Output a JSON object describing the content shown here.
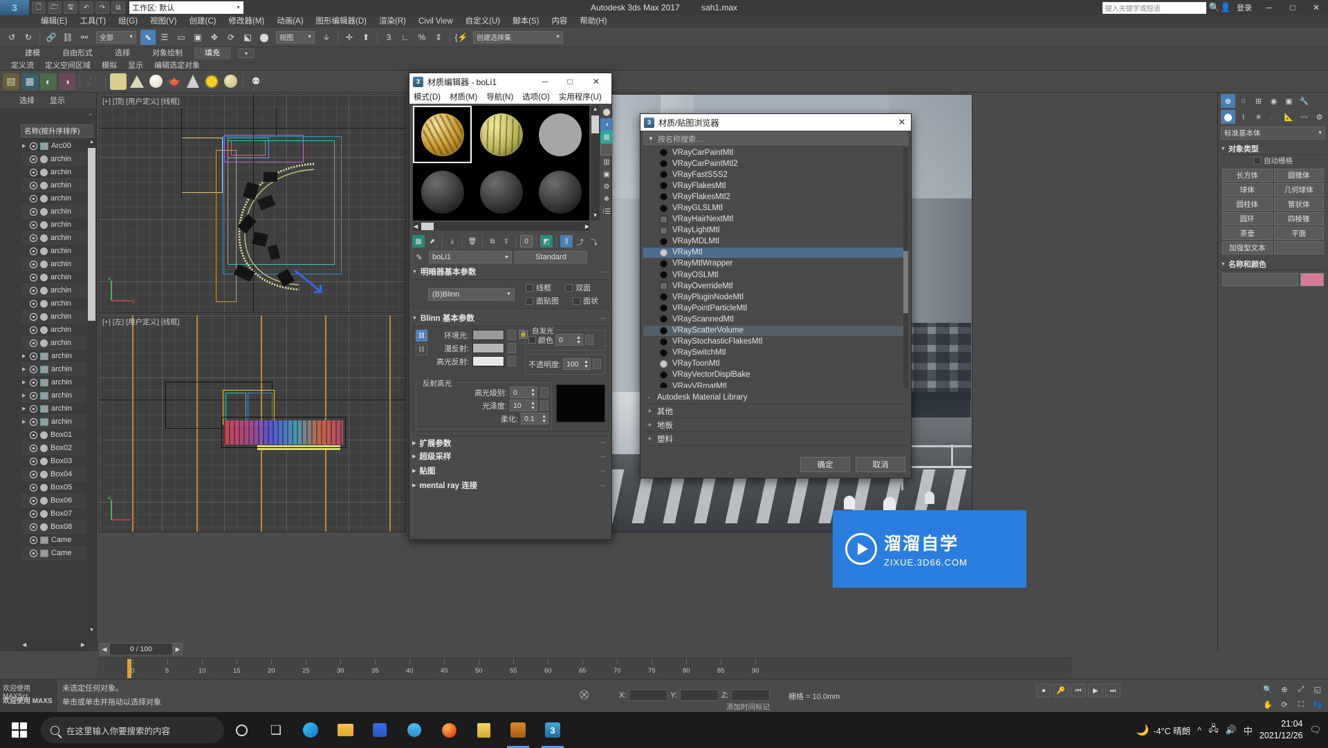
{
  "titlebar": {
    "logo": "MAX",
    "workspace": "工作区: 默认",
    "title": "Autodesk 3ds Max 2017",
    "filename": "sah1.max",
    "search_placeholder": "键入关键字或短语",
    "login": "登录",
    "icons": [
      "new-icon",
      "open-icon",
      "save-icon",
      "undo-icon",
      "redo-icon",
      "set-icon"
    ],
    "min": "─",
    "max": "□",
    "close": "✕"
  },
  "menubar": {
    "items": [
      "编辑(E)",
      "工具(T)",
      "组(G)",
      "视图(V)",
      "创建(C)",
      "修改器(M)",
      "动画(A)",
      "图形编辑器(D)",
      "渲染(R)",
      "Civil View",
      "自定义(U)",
      "脚本(S)",
      "内容",
      "帮助(H)"
    ]
  },
  "maintoolbar": {
    "select_filter": "全部",
    "ref_coord": "视图",
    "selection_set": "创建选择集"
  },
  "ribbon": {
    "tabs": [
      "建模",
      "自由形式",
      "选择",
      "对象绘制",
      "填充"
    ],
    "selected_tab": "填充",
    "subtabs": [
      "定义流",
      "定义空间区域",
      "模拟",
      "显示",
      "编辑选定对象"
    ]
  },
  "left_panel": {
    "tabs": [
      "选择",
      "显示"
    ],
    "column_header": "名称(按升序排序)",
    "items": [
      {
        "label": "Arc00",
        "type": "group"
      },
      {
        "label": "archin",
        "type": "obj"
      },
      {
        "label": "archin",
        "type": "obj"
      },
      {
        "label": "archin",
        "type": "obj"
      },
      {
        "label": "archin",
        "type": "obj"
      },
      {
        "label": "archin",
        "type": "obj"
      },
      {
        "label": "archin",
        "type": "obj"
      },
      {
        "label": "archin",
        "type": "obj"
      },
      {
        "label": "archin",
        "type": "obj"
      },
      {
        "label": "archin",
        "type": "obj"
      },
      {
        "label": "archin",
        "type": "obj"
      },
      {
        "label": "archin",
        "type": "obj"
      },
      {
        "label": "archin",
        "type": "obj"
      },
      {
        "label": "archin",
        "type": "obj"
      },
      {
        "label": "archin",
        "type": "obj"
      },
      {
        "label": "archin",
        "type": "obj"
      },
      {
        "label": "archin",
        "type": "grp"
      },
      {
        "label": "archin",
        "type": "grp"
      },
      {
        "label": "archin",
        "type": "grp"
      },
      {
        "label": "archin",
        "type": "grp"
      },
      {
        "label": "archin",
        "type": "grp"
      },
      {
        "label": "archin",
        "type": "grp"
      },
      {
        "label": "Box01",
        "type": "obj"
      },
      {
        "label": "Box02",
        "type": "obj"
      },
      {
        "label": "Box03",
        "type": "obj"
      },
      {
        "label": "Box04",
        "type": "obj"
      },
      {
        "label": "Box05",
        "type": "obj"
      },
      {
        "label": "Box06",
        "type": "obj"
      },
      {
        "label": "Box07",
        "type": "obj"
      },
      {
        "label": "Box08",
        "type": "obj"
      },
      {
        "label": "Came",
        "type": "cam"
      },
      {
        "label": "Came",
        "type": "cam"
      }
    ]
  },
  "viewports": {
    "top": "[+] [顶] [用户定义] [线框]",
    "left": "[+] [左] [用户定义] [线框]",
    "persp": "[+] [透视] [真实]"
  },
  "timeline": {
    "frame_display": "0 / 100",
    "ticks": [
      "0",
      "5",
      "10",
      "15",
      "20",
      "25",
      "30",
      "35",
      "40",
      "45",
      "50",
      "55",
      "60",
      "65",
      "70",
      "75",
      "80",
      "85",
      "90"
    ]
  },
  "status": {
    "maxscript_line1": "欢迎使用 MAXScr",
    "maxscript_line2": "欢迎使用 MAXS",
    "line1": "未选定任何对象。",
    "line2": "单击或单击并拖动以选择对象",
    "x_label": "X:",
    "y_label": "Y:",
    "z_label": "Z:",
    "x_value": "",
    "y_value": "",
    "z_value": "",
    "grid": "栅格 = 10.0mm",
    "addkey": "添加时间标记"
  },
  "command_panel": {
    "object_type_label": "对象类型",
    "autogrid": "自动栅格",
    "category": "标准基本体",
    "buttons": [
      "长方体",
      "圆锥体",
      "球体",
      "几何球体",
      "圆柱体",
      "管状体",
      "圆环",
      "四棱锥",
      "茶壶",
      "平面",
      "加强型文本",
      ""
    ],
    "name_color_label": "名称和颜色",
    "color": "#d67a96"
  },
  "material_editor": {
    "title": "材质编辑器 - boLi1",
    "menu": [
      "模式(D)",
      "材质(M)",
      "导航(N)",
      "选项(O)",
      "实用程序(U)"
    ],
    "material_name": "boLi1",
    "type_button": "Standard",
    "shader_rollout": "明暗器基本参数",
    "shader_type": "(B)Blinn",
    "wire_label": "线框",
    "twosided_label": "双面",
    "facemap_label": "面贴图",
    "faceted_label": "面状",
    "basic_rollout": "Blinn 基本参数",
    "ambient_label": "环境光:",
    "diffuse_label": "漫反射:",
    "specular_label": "高光反射:",
    "selfillum_group": "自发光",
    "color_label": "颜色",
    "selfillum_value": "0",
    "opacity_label": "不透明度:",
    "opacity_value": "100",
    "spechl_group": "反射高光",
    "speclevel_label": "高光级别:",
    "speclevel_value": "0",
    "glossiness_label": "光泽度:",
    "glossiness_value": "10",
    "soften_label": "柔化:",
    "soften_value": "0.1",
    "rollouts": [
      "扩展参数",
      "超级采样",
      "贴图",
      "mental ray 连接"
    ]
  },
  "material_browser": {
    "title": "材质/贴图浏览器",
    "search_placeholder": "按名称搜索…",
    "items": [
      {
        "label": "VRayCarPaintMtl",
        "icon": "dark"
      },
      {
        "label": "VRayCarPaintMtl2",
        "icon": "dark"
      },
      {
        "label": "VRayFastSSS2",
        "icon": "dark"
      },
      {
        "label": "VRayFlakesMtl",
        "icon": "dark"
      },
      {
        "label": "VRayFlakesMtl2",
        "icon": "dark"
      },
      {
        "label": "VRayGLSLMtl",
        "icon": "dark"
      },
      {
        "label": "VRayHairNextMtl",
        "icon": "square"
      },
      {
        "label": "VRayLightMtl",
        "icon": "square"
      },
      {
        "label": "VRayMDLMtl",
        "icon": "dark"
      },
      {
        "label": "VRayMtl",
        "icon": "light",
        "state": "selected"
      },
      {
        "label": "VRayMtlWrapper",
        "icon": "dark"
      },
      {
        "label": "VRayOSLMtl",
        "icon": "dark"
      },
      {
        "label": "VRayOverrideMtl",
        "icon": "square"
      },
      {
        "label": "VRayPluginNodeMtl",
        "icon": "dark"
      },
      {
        "label": "VRayPointParticleMtl",
        "icon": "dark"
      },
      {
        "label": "VRayScannedMtl",
        "icon": "dark"
      },
      {
        "label": "VRayScatterVolume",
        "icon": "dark",
        "state": "highlight"
      },
      {
        "label": "VRayStochasticFlakesMtl",
        "icon": "dark"
      },
      {
        "label": "VRaySwitchMtl",
        "icon": "dark"
      },
      {
        "label": "VRayToonMtl",
        "icon": "light"
      },
      {
        "label": "VRayVectorDisplBake",
        "icon": "dark"
      },
      {
        "label": "VRayVRmatMtl",
        "icon": "dark"
      }
    ],
    "categories": [
      {
        "sign": "-",
        "label": "Autodesk Material Library"
      },
      {
        "sign": "+",
        "label": "其他"
      },
      {
        "sign": "+",
        "label": "地板"
      },
      {
        "sign": "+",
        "label": "塑料"
      }
    ],
    "ok_button": "确定",
    "cancel_button": "取消"
  },
  "watermark": {
    "line1": "溜溜自学",
    "line2": "ZIXUE.3D66.COM"
  },
  "taskbar": {
    "search_placeholder": "在这里输入你要搜索的内容",
    "weather": "-4°C  晴朗",
    "time": "21:04",
    "date": "2021/12/26",
    "lang": "中"
  }
}
